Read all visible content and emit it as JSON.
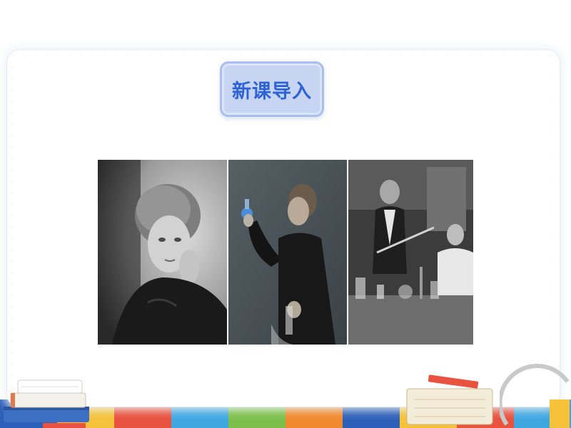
{
  "slide": {
    "title": "新课导入"
  },
  "photos": [
    {
      "name": "portrait-photo",
      "description_icon": "portrait-photo-icon"
    },
    {
      "name": "flask-photo",
      "description_icon": "flask-photo-icon"
    },
    {
      "name": "laboratory-photo",
      "description_icon": "lab-photo-icon"
    }
  ],
  "colors": {
    "title_text": "#2e63d6",
    "title_bg": "#c7d5f3",
    "title_border": "#a9bff0",
    "strip": [
      "#2c5fb8",
      "#f5c23a",
      "#e8523e",
      "#3fa7e0",
      "#7cc04b",
      "#f08a2c",
      "#2c5fb8",
      "#f5c23a",
      "#e8523e",
      "#3fa7e0"
    ]
  }
}
